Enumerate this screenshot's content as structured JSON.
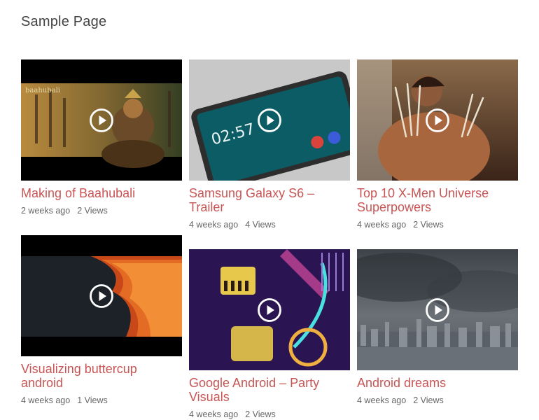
{
  "page": {
    "title": "Sample Page"
  },
  "videos": [
    {
      "title": "Making of Baahubali",
      "age": "2 weeks ago",
      "views": "2 Views",
      "thumb_text": "baahubali"
    },
    {
      "title": "Samsung Galaxy S6 – Trailer",
      "age": "4 weeks ago",
      "views": "4 Views",
      "thumb_text": "02:57"
    },
    {
      "title": "Top 10 X-Men Universe Superpowers",
      "age": "4 weeks ago",
      "views": "2 Views"
    },
    {
      "title": "Visualizing buttercup android",
      "age": "4 weeks ago",
      "views": "1 Views"
    },
    {
      "title": "Google Android – Party Visuals",
      "age": "4 weeks ago",
      "views": "2 Views"
    },
    {
      "title": "Android dreams",
      "age": "4 weeks ago",
      "views": "2 Views"
    }
  ],
  "icons": {
    "play": "play-circle-icon"
  },
  "colors": {
    "title_link": "#c85555",
    "meta_text": "#666666",
    "page_title": "#444444"
  }
}
